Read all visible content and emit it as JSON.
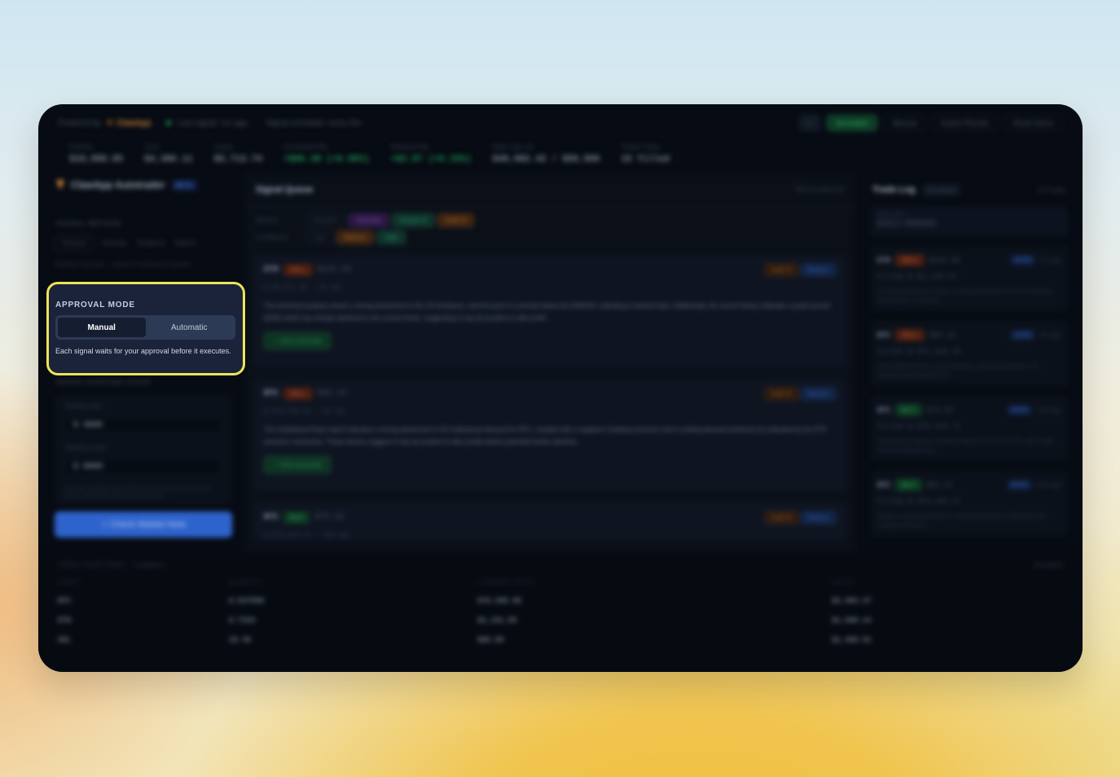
{
  "topbar": {
    "powered_by": "Powered by",
    "brand": "ClawApp",
    "last_signal": "Last signal: 1m ago",
    "schedule": "Signal schedule: every 5m",
    "simulated_label": "Simulated",
    "manual_label": "Manual",
    "export_label": "Export Results",
    "reset_label": "Reset Demo"
  },
  "stats": [
    {
      "label": "Portfolio",
      "value": "$10,099.05"
    },
    {
      "label": "Cash",
      "value": "$4,386.11"
    },
    {
      "label": "Crypto",
      "value": "$5,713.74"
    },
    {
      "label": "Unrealized P&L",
      "value": "+$96.38 (+0.96%)"
    },
    {
      "label": "Realized P&L",
      "value": "+$3.97 (+0.33%)"
    },
    {
      "label": "Daily Cap Left",
      "value": "$48,082.42 / $50,000"
    },
    {
      "label": "Trades Today",
      "value": "15 filled"
    }
  ],
  "left": {
    "title": "ClawApp Autotrader",
    "badge": "BETA",
    "signal_method_heading": "SIGNAL METHOD",
    "methods": [
      "Random",
      "Heuristic",
      "Simple AI",
      "Swift AI"
    ],
    "method_hint": "Random buy/sell — great for testing the system",
    "paper_heading": "PAPER STARTING STATE",
    "starting_cash_label": "Starting cash",
    "starting_cash_value": "$ 4000",
    "starting_crypto_label": "Starting crypto",
    "starting_crypto_value": "$ 6000",
    "paper_note": "On reset, portfolio starts with this cash and crypto (no real funds). Edit before demo-related assets.",
    "check_button": "Check Market Now"
  },
  "approval": {
    "title": "APPROVAL MODE",
    "options": [
      "Manual",
      "Automatic"
    ],
    "active": "Manual",
    "description": "Each signal waits for your approval before it executes."
  },
  "queue": {
    "title": "Signal Queue",
    "mode_note": "Manual approval",
    "method_label": "Method",
    "method_chips": [
      "Random",
      "Heuristic",
      "Simple AI",
      "Swift AI"
    ],
    "confidence_label": "Confidence",
    "confidence_chips": [
      "Low",
      "Medium",
      "High"
    ],
    "cards": [
      {
        "symbol": "ETH",
        "action": "SELL",
        "amount": "$101.86",
        "sub": "@ $2,151.38 · 1m ago",
        "tag1": "Swift AI",
        "tag2": "Medium",
        "body": "The technical analysis shows a strong downtrend in the 1D timeframe, and the price is currently below the EMA200, indicating a bearish bias. Additionally, the recent history indicates a peak around $2352 which has sharply declined to the current levels, suggesting it may be prudent to take profit.",
        "exec": "✓ Auto-executed"
      },
      {
        "symbol": "BTC",
        "action": "SELL",
        "amount": "$66.24",
        "sub": "@ $76,388.82 · 4m ago",
        "tag1": "Swift AI",
        "tag2": "Medium",
        "body": "The institutional flows report indicates a strong downtrend in US institutional demand for BTC, coupled with a negative Coinbase premium and a cooling demand sentiment as indicated by the ETF premium contraction. These factors suggest it may be prudent to take profits before potential further declines.",
        "exec": "✓ Auto-executed"
      },
      {
        "symbol": "BTC",
        "action": "BUY",
        "amount": "$75.52",
        "sub": "@ $76,364.76 · 13m ago",
        "tag1": "Swift AI",
        "tag2": "Medium",
        "body": "",
        "exec": ""
      }
    ]
  },
  "tradelog": {
    "title": "Trade Log",
    "sim_badge": "Simulated",
    "count": "15 Trades",
    "daily_spent_label": "Daily spent",
    "daily_spent_value": "$1917/$50000",
    "items": [
      {
        "symbol": "ETH",
        "action": "SELL",
        "amount": "$101.86",
        "auto": "AUTO",
        "ago": "1m ago",
        "filled": "Filled @ $2,149.33",
        "desc": "The technical analysis shows a strong downtrend in the 1D timeframe, and the price is currently..."
      },
      {
        "symbol": "BTC",
        "action": "SELL",
        "amount": "$66.24",
        "auto": "AUTO",
        "ago": "4m ago",
        "filled": "Filled @ $76,329.45",
        "desc": "The institutional flows report indicates a strong downtrend in US institutional demand for BTC..."
      },
      {
        "symbol": "BTC",
        "action": "BUY",
        "amount": "$75.52",
        "auto": "AUTO",
        "ago": "13m ago",
        "filled": "Filled @ $76,434.71",
        "desc": "The analysis indicates sustained inflows to US BTC ETFs, with a daily net flow of $804M and..."
      },
      {
        "symbol": "BTC",
        "action": "BUY",
        "amount": "$51.47",
        "auto": "AUTO",
        "ago": "13m ago",
        "filled": "Filled @ $76,469.47",
        "desc": "Despite a strong downtrend in institutional demand reflected by the Coinbase Premium..."
      }
    ]
  },
  "positions": {
    "title": "OPEN POSITIONS",
    "count": "3 positions",
    "mode": "Simulated",
    "columns": [
      "ASSET",
      "QUANTITY",
      "CURRENT PRICE",
      "VALUE"
    ],
    "rows": [
      [
        "BTC",
        "0.037850",
        "$76,399.96",
        "$2,464.47"
      ],
      [
        "ETH",
        "0.7343",
        "$2,151.85",
        "$1,580.14"
      ],
      [
        "SOL",
        "16.49",
        "$89.08",
        "$1,468.91"
      ]
    ]
  }
}
